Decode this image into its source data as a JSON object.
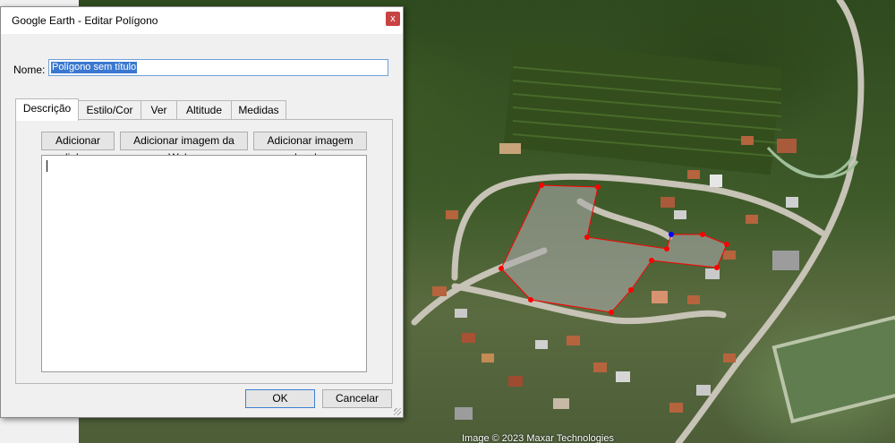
{
  "dialog": {
    "title": "Google Earth - Editar Polígono",
    "close_label": "x",
    "name_label": "Nome:",
    "name_value": "Polígono sem título",
    "tabs": [
      {
        "label": "Descrição",
        "active": true
      },
      {
        "label": "Estilo/Cor",
        "active": false
      },
      {
        "label": "Ver",
        "active": false
      },
      {
        "label": "Altitude",
        "active": false
      },
      {
        "label": "Medidas",
        "active": false
      }
    ],
    "buttons": {
      "add_link": "Adicionar link...",
      "add_web_image": "Adicionar imagem da Web...",
      "add_local_image": "Adicionar imagem local...",
      "ok": "OK",
      "cancel": "Cancelar"
    },
    "description_value": ""
  },
  "map": {
    "copyright": "Image © 2023 Maxar Technologies",
    "polygon_color": "#ff0000",
    "vertex_color": "#ff0000",
    "active_vertex_color": "#0000ff"
  }
}
